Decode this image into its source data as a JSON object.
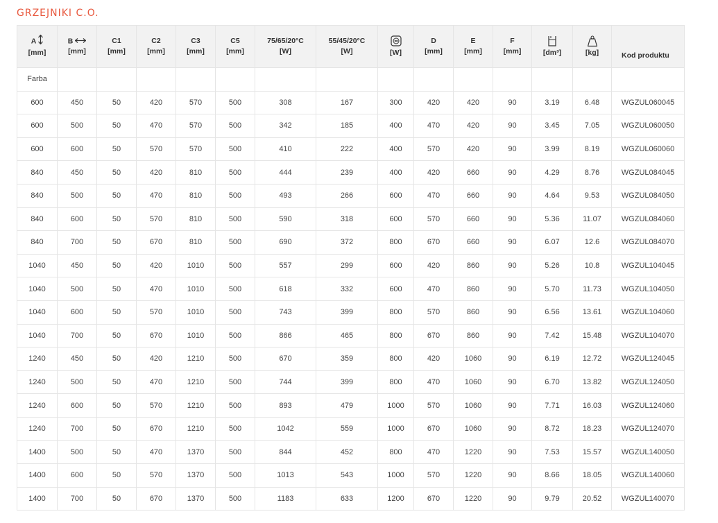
{
  "page_title": "GRZEJNIKI C.O.",
  "colors": {
    "title": "#e8593f",
    "header_bg": "#f2f2f2",
    "border": "#e5e5e5"
  },
  "columns": [
    {
      "label": "A",
      "unit": "[mm]",
      "icon": "vertical-arrow-icon"
    },
    {
      "label": "B",
      "unit": "[mm]",
      "icon": "horizontal-arrow-icon"
    },
    {
      "label": "C1",
      "unit": "[mm]"
    },
    {
      "label": "C2",
      "unit": "[mm]"
    },
    {
      "label": "C3",
      "unit": "[mm]"
    },
    {
      "label": "C5",
      "unit": "[mm]"
    },
    {
      "label": "75/65/20°C",
      "unit": "[W]"
    },
    {
      "label": "55/45/20°C",
      "unit": "[W]"
    },
    {
      "label": "",
      "unit": "[W]",
      "icon": "heating-element-icon"
    },
    {
      "label": "D",
      "unit": "[mm]"
    },
    {
      "label": "E",
      "unit": "[mm]"
    },
    {
      "label": "F",
      "unit": "[mm]"
    },
    {
      "label": "",
      "unit": "[dm³]",
      "icon": "water-capacity-icon"
    },
    {
      "label": "",
      "unit": "[kg]",
      "icon": "weight-icon"
    },
    {
      "label": "Kod produktu",
      "unit": ""
    }
  ],
  "farba_label": "Farba",
  "rows": [
    [
      "600",
      "450",
      "50",
      "420",
      "570",
      "500",
      "308",
      "167",
      "300",
      "420",
      "420",
      "90",
      "3.19",
      "6.48",
      "WGZUL060045"
    ],
    [
      "600",
      "500",
      "50",
      "470",
      "570",
      "500",
      "342",
      "185",
      "400",
      "470",
      "420",
      "90",
      "3.45",
      "7.05",
      "WGZUL060050"
    ],
    [
      "600",
      "600",
      "50",
      "570",
      "570",
      "500",
      "410",
      "222",
      "400",
      "570",
      "420",
      "90",
      "3.99",
      "8.19",
      "WGZUL060060"
    ],
    [
      "840",
      "450",
      "50",
      "420",
      "810",
      "500",
      "444",
      "239",
      "400",
      "420",
      "660",
      "90",
      "4.29",
      "8.76",
      "WGZUL084045"
    ],
    [
      "840",
      "500",
      "50",
      "470",
      "810",
      "500",
      "493",
      "266",
      "600",
      "470",
      "660",
      "90",
      "4.64",
      "9.53",
      "WGZUL084050"
    ],
    [
      "840",
      "600",
      "50",
      "570",
      "810",
      "500",
      "590",
      "318",
      "600",
      "570",
      "660",
      "90",
      "5.36",
      "11.07",
      "WGZUL084060"
    ],
    [
      "840",
      "700",
      "50",
      "670",
      "810",
      "500",
      "690",
      "372",
      "800",
      "670",
      "660",
      "90",
      "6.07",
      "12.6",
      "WGZUL084070"
    ],
    [
      "1040",
      "450",
      "50",
      "420",
      "1010",
      "500",
      "557",
      "299",
      "600",
      "420",
      "860",
      "90",
      "5.26",
      "10.8",
      "WGZUL104045"
    ],
    [
      "1040",
      "500",
      "50",
      "470",
      "1010",
      "500",
      "618",
      "332",
      "600",
      "470",
      "860",
      "90",
      "5.70",
      "11.73",
      "WGZUL104050"
    ],
    [
      "1040",
      "600",
      "50",
      "570",
      "1010",
      "500",
      "743",
      "399",
      "800",
      "570",
      "860",
      "90",
      "6.56",
      "13.61",
      "WGZUL104060"
    ],
    [
      "1040",
      "700",
      "50",
      "670",
      "1010",
      "500",
      "866",
      "465",
      "800",
      "670",
      "860",
      "90",
      "7.42",
      "15.48",
      "WGZUL104070"
    ],
    [
      "1240",
      "450",
      "50",
      "420",
      "1210",
      "500",
      "670",
      "359",
      "800",
      "420",
      "1060",
      "90",
      "6.19",
      "12.72",
      "WGZUL124045"
    ],
    [
      "1240",
      "500",
      "50",
      "470",
      "1210",
      "500",
      "744",
      "399",
      "800",
      "470",
      "1060",
      "90",
      "6.70",
      "13.82",
      "WGZUL124050"
    ],
    [
      "1240",
      "600",
      "50",
      "570",
      "1210",
      "500",
      "893",
      "479",
      "1000",
      "570",
      "1060",
      "90",
      "7.71",
      "16.03",
      "WGZUL124060"
    ],
    [
      "1240",
      "700",
      "50",
      "670",
      "1210",
      "500",
      "1042",
      "559",
      "1000",
      "670",
      "1060",
      "90",
      "8.72",
      "18.23",
      "WGZUL124070"
    ],
    [
      "1400",
      "500",
      "50",
      "470",
      "1370",
      "500",
      "844",
      "452",
      "800",
      "470",
      "1220",
      "90",
      "7.53",
      "15.57",
      "WGZUL140050"
    ],
    [
      "1400",
      "600",
      "50",
      "570",
      "1370",
      "500",
      "1013",
      "543",
      "1000",
      "570",
      "1220",
      "90",
      "8.66",
      "18.05",
      "WGZUL140060"
    ],
    [
      "1400",
      "700",
      "50",
      "670",
      "1370",
      "500",
      "1183",
      "633",
      "1200",
      "670",
      "1220",
      "90",
      "9.79",
      "20.52",
      "WGZUL140070"
    ]
  ]
}
